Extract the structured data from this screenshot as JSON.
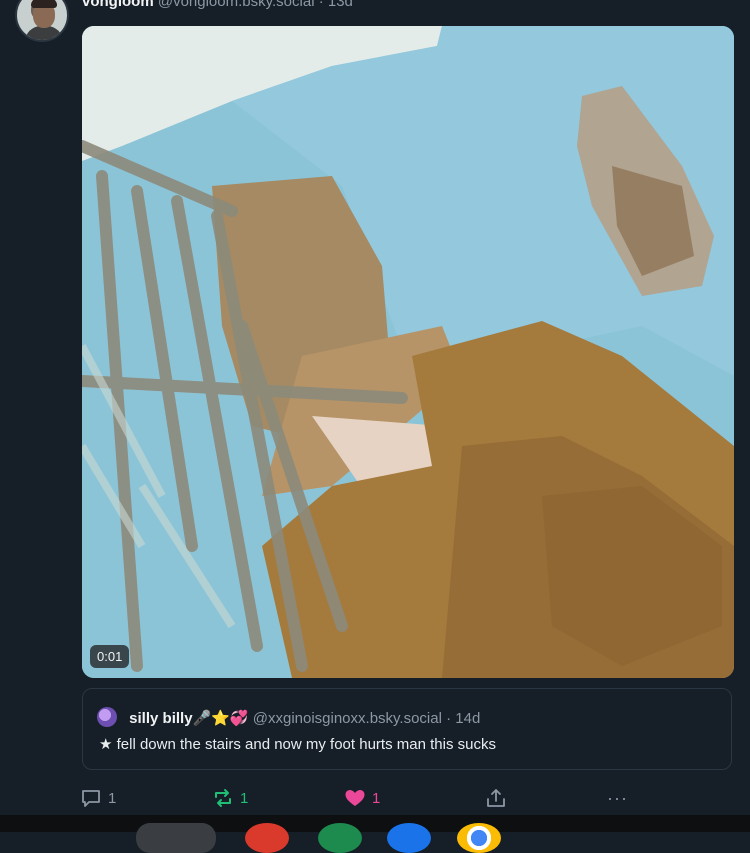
{
  "post": {
    "author": {
      "display_name": "vongloom",
      "handle": "@vongloom.bsky.social",
      "separator": "·",
      "time": "13d"
    },
    "media": {
      "duration": "0:01"
    },
    "quote": {
      "display_name": "silly billy🎤⭐💞",
      "handle": "@xxginoisginoxx.bsky.social",
      "separator": "·",
      "time": "14d",
      "text": "★ fell down the stairs and now my foot hurts man this sucks"
    },
    "actions": {
      "reply_count": "1",
      "repost_count": "1",
      "like_count": "1",
      "more_label": "···"
    },
    "colors": {
      "background": "#161e27",
      "repost": "#1fbf76",
      "like": "#ec4899",
      "muted": "#8b98a5"
    }
  },
  "taskbar": {
    "icons": [
      "app-icon",
      "red-app-icon",
      "green-app-icon",
      "blue-app-icon",
      "chrome-icon"
    ]
  }
}
